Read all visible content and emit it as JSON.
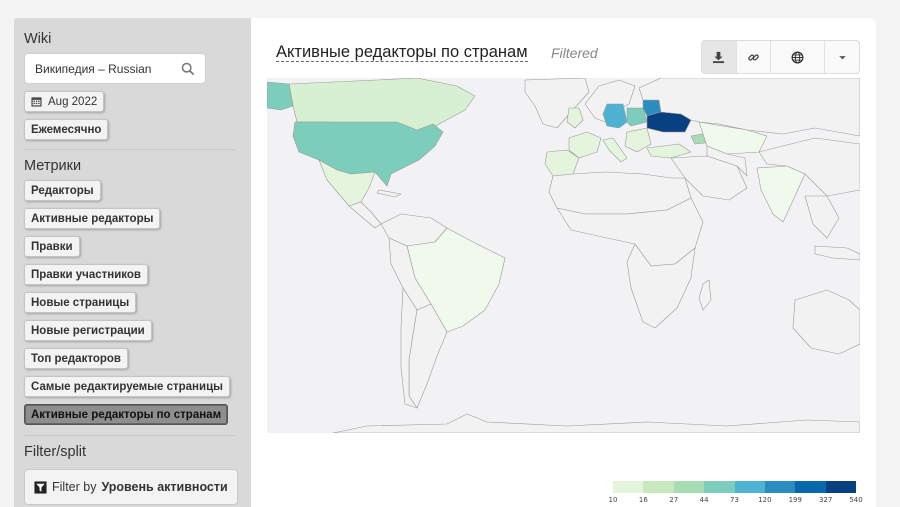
{
  "sidebar": {
    "wiki_title": "Wiki",
    "wiki_value": "Википедия – Russian",
    "date_button": "Aug 2022",
    "granularity_button": "Ежемесячно",
    "metrics_title": "Метрики",
    "metrics": [
      "Редакторы",
      "Активные редакторы",
      "Правки",
      "Правки участников",
      "Новые страницы",
      "Новые регистрации",
      "Топ редакторов",
      "Самые редактируемые страницы",
      "Активные редакторы по странам"
    ],
    "active_metric": "Активные редакторы по странам",
    "filter_title": "Filter/split",
    "filter_prefix": "Filter by",
    "filter_value": "Уровень активности"
  },
  "panel": {
    "title": "Активные редакторы по странам",
    "subtitle": "Filtered",
    "toolbar": [
      "download-icon",
      "link-icon",
      "globe-icon",
      "caret-down-icon"
    ]
  },
  "legend": {
    "values": [
      "10",
      "16",
      "27",
      "44",
      "73",
      "120",
      "199",
      "327",
      "540"
    ],
    "colors": [
      "#e4f4dd",
      "#c7e9c0",
      "#a8dcb5",
      "#7ccdbb",
      "#4eb3d3",
      "#2b8cbe",
      "#0868ac",
      "#084081"
    ]
  },
  "countries": {
    "Ukraine": "540",
    "Germany": "73",
    "United States": "44"
  }
}
